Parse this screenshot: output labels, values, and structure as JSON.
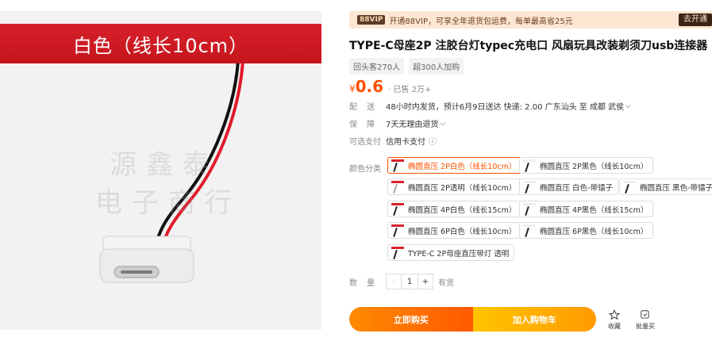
{
  "image": {
    "banner": "白色（线长10cm）",
    "watermark_line1": "源鑫泰",
    "watermark_line2": "电子商行"
  },
  "vip": {
    "badge": "88VIP",
    "text": "开通88VIP，可享全年退货包运费，每单最高省25元",
    "open_label": "去开通"
  },
  "product": {
    "title": "TYPE-C母座2P 注胶台灯typec充电口 风扇玩具改装剃须刀usb连接器",
    "tags": [
      "回头客270人",
      "超300人加购"
    ],
    "price_symbol": "¥",
    "price": "0.6",
    "sold": "· 已售 2万+"
  },
  "shipping": {
    "label": "配送",
    "text": "48小时内发货，预计6月9日送达  快递: 2.00  广东汕头 至 成都 武侯"
  },
  "guarantee": {
    "label": "保障",
    "text": "7天无理由退货"
  },
  "payment": {
    "label": "可选支付",
    "text": "信用卡支付",
    "info_icon": "ⓘ"
  },
  "variants": {
    "label": "颜色分类",
    "items": [
      {
        "label": "椭圆直压 2P白色（线长10cm）",
        "selected": true
      },
      {
        "label": "椭圆直压 2P黑色（线长10cm）",
        "selected": false
      },
      {
        "label": "椭圆直压 2P透明（线长10cm）",
        "selected": false
      },
      {
        "label": "椭圆直压 白色-带镭子",
        "selected": false
      },
      {
        "label": "椭圆直压 黑色-带镭子",
        "selected": false
      },
      {
        "label": "椭圆直压 4P白色（线长15cm）",
        "selected": false
      },
      {
        "label": "椭圆直压 4P黑色（线长15cm）",
        "selected": false
      },
      {
        "label": "椭圆直压 6P白色（线长10cm）",
        "selected": false
      },
      {
        "label": "椭圆直压 6P黑色（线长10cm）",
        "selected": false
      },
      {
        "label": "TYPE-C 2P母座直压带灯 透明",
        "selected": false
      }
    ]
  },
  "quantity": {
    "label": "数量",
    "minus": "-",
    "value": "1",
    "plus": "+",
    "stock": "有货"
  },
  "actions": {
    "buy_now": "立即购买",
    "add_cart": "加入购物车",
    "favorite": "收藏",
    "bulk_buy": "批量买"
  },
  "colors": {
    "accent": "#ff5000",
    "banner": "#c4161c"
  }
}
